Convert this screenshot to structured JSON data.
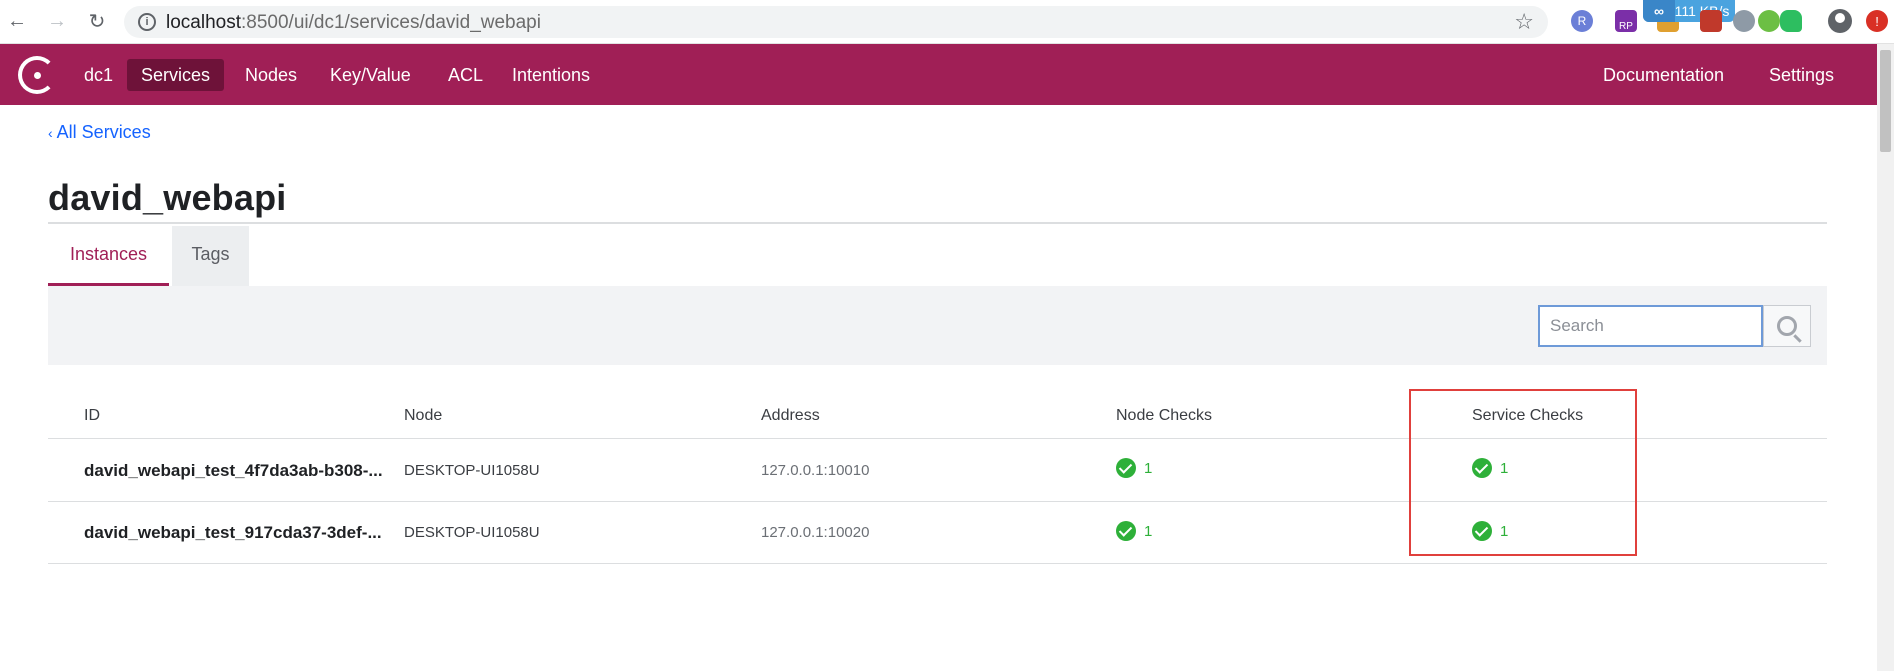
{
  "browser": {
    "url_host": "localhost",
    "url_path": ":8500/ui/dc1/services/david_webapi",
    "speed": "111 KB/s",
    "speed_icon": "∞",
    "ext_letter": "R",
    "ext_badge": "RP"
  },
  "header": {
    "datacenter": "dc1",
    "nav": [
      "Services",
      "Nodes",
      "Key/Value",
      "ACL",
      "Intentions"
    ],
    "right_nav": [
      "Documentation",
      "Settings"
    ]
  },
  "page": {
    "back_link": "All Services",
    "title": "david_webapi",
    "tabs": [
      "Instances",
      "Tags"
    ],
    "search_placeholder": "Search"
  },
  "table": {
    "columns": [
      "ID",
      "Node",
      "Address",
      "Node Checks",
      "Service Checks"
    ],
    "rows": [
      {
        "id": "david_webapi_test_4f7da3ab-b308-...",
        "node": "DESKTOP-UI1058U",
        "address": "127.0.0.1:10010",
        "node_checks": "1",
        "service_checks": "1"
      },
      {
        "id": "david_webapi_test_917cda37-3def-...",
        "node": "DESKTOP-UI1058U",
        "address": "127.0.0.1:10020",
        "node_checks": "1",
        "service_checks": "1"
      }
    ]
  },
  "colors": {
    "brand": "#a01f56",
    "link": "#1563ff",
    "passing": "#2eb039",
    "highlight": "#e0403c"
  }
}
